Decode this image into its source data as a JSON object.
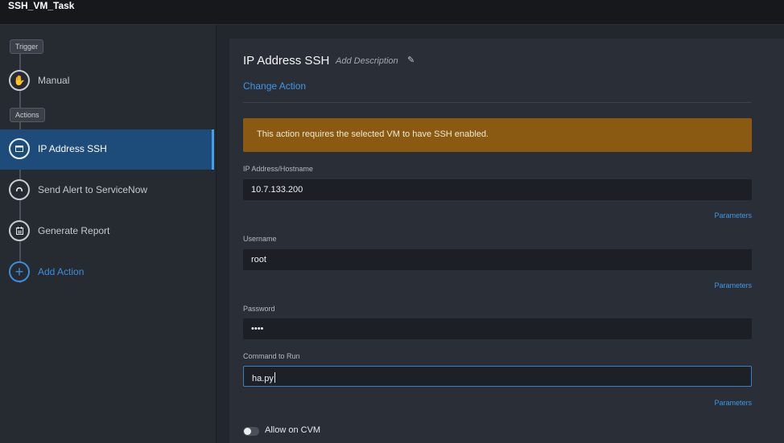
{
  "app": {
    "title": "SSH_VM_Task"
  },
  "sidebar": {
    "trigger_tag": "Trigger",
    "actions_tag": "Actions",
    "items": [
      {
        "label": "Manual",
        "icon": "hand-icon"
      },
      {
        "label": "IP Address SSH",
        "icon": "terminal-icon",
        "active": true
      },
      {
        "label": "Send Alert to ServiceNow",
        "icon": "servicenow-icon"
      },
      {
        "label": "Generate Report",
        "icon": "report-icon"
      },
      {
        "label": "Add Action",
        "icon": "plus-icon"
      }
    ]
  },
  "panel": {
    "title": "IP Address SSH",
    "add_description": "Add Description",
    "change_action": "Change Action",
    "warning": "This action requires the selected VM to have SSH enabled.",
    "fields": {
      "ip": {
        "label": "IP Address/Hostname",
        "value": "10.7.133.200"
      },
      "username": {
        "label": "Username",
        "value": "root"
      },
      "password": {
        "label": "Password",
        "value": "••••"
      },
      "command": {
        "label": "Command to Run",
        "value": "ha.py"
      }
    },
    "parameters_label": "Parameters",
    "allow_cvm": {
      "label": "Allow on CVM",
      "enabled": false
    }
  },
  "colors": {
    "accent": "#3c98e8",
    "active_bg": "#1d4c7a",
    "warning_bg": "#8a5a12"
  }
}
